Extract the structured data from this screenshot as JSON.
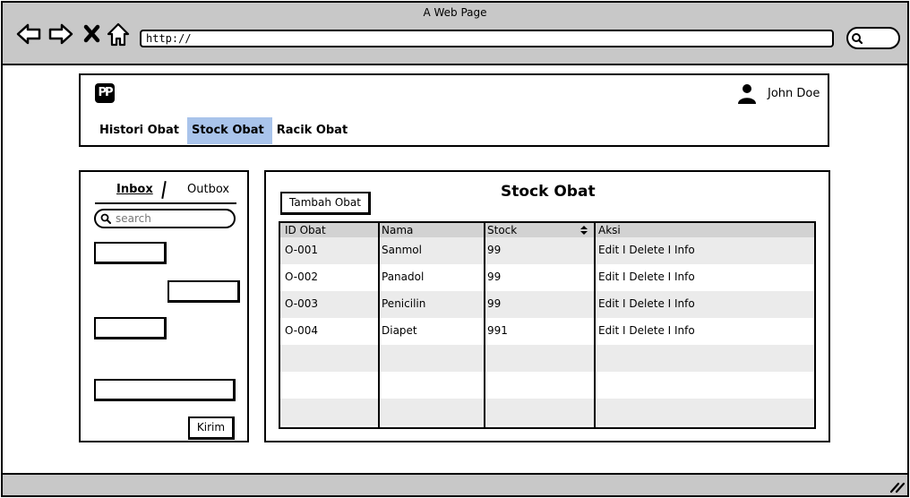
{
  "window": {
    "title": "A Web Page",
    "url": "http://"
  },
  "header": {
    "logo_text": "PP",
    "user_name": "John Doe",
    "tabs": [
      {
        "label": "Histori Obat",
        "active": false
      },
      {
        "label": "Stock Obat",
        "active": true
      },
      {
        "label": "Racik Obat",
        "active": false
      }
    ]
  },
  "sidebar": {
    "tabs": [
      "Inbox",
      "Outbox"
    ],
    "search_placeholder": "search",
    "send_label": "Kirim"
  },
  "main": {
    "title": "Stock Obat",
    "add_button": "Tambah Obat",
    "columns": [
      "ID Obat",
      "Nama",
      "Stock",
      "Aksi"
    ],
    "rows": [
      [
        "O-001",
        "Sanmol",
        "99",
        "Edit I Delete I Info"
      ],
      [
        "O-002",
        "Panadol",
        "99",
        "Edit I Delete I Info"
      ],
      [
        "O-003",
        "Penicilin",
        "99",
        "Edit I Delete I Info"
      ],
      [
        "O-004",
        "Diapet",
        "991",
        "Edit I Delete I Info"
      ]
    ]
  },
  "colors": {
    "active_tab": "#a9c4eb",
    "chrome": "#c8c8c8",
    "grid_header": "#d2d2d2",
    "grid_alt_row": "#ebebeb"
  },
  "icons": [
    "back-arrow-icon",
    "forward-arrow-icon",
    "close-x-icon",
    "home-icon",
    "search-icon",
    "user-icon",
    "sort-icon",
    "resize-grip-icon"
  ]
}
